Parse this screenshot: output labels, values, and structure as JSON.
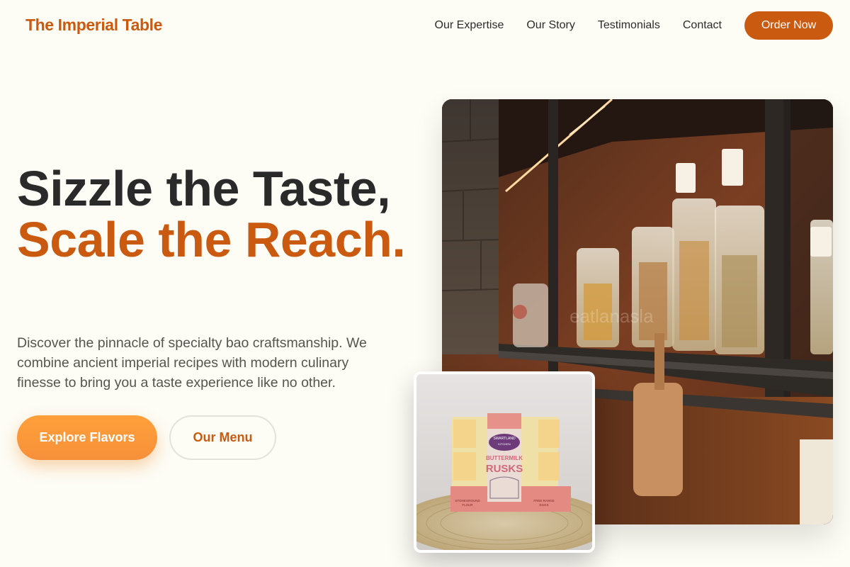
{
  "header": {
    "brand": "The Imperial Table",
    "nav": [
      {
        "label": "Our Expertise"
      },
      {
        "label": "Our Story"
      },
      {
        "label": "Testimonials"
      },
      {
        "label": "Contact"
      }
    ],
    "cta": "Order Now"
  },
  "hero": {
    "title_line1": "Sizzle the Taste,",
    "title_accent": "Scale the Reach.",
    "description": "Discover the pinnacle of specialty bao craftsmanship. We combine ancient imperial recipes with modern culinary finesse to bring you a taste experience like no other.",
    "primary_button": "Explore Flavors",
    "secondary_button": "Our Menu"
  },
  "images": {
    "main": {
      "icon": "pantry-shelves-photo",
      "watermark": "eatlanasla"
    },
    "thumb": {
      "icon": "rusks-package-photo",
      "brand_text": "SWARTLAND KITCHEN",
      "product_text": "BUTTERMILK RUSKS",
      "left_tag": "STONEGROUND FLOUR",
      "right_tag": "FREE RANGE EGGS"
    }
  },
  "colors": {
    "accent": "#c95a10",
    "button_primary": "#f7903a",
    "background": "#fdfcf5",
    "text": "#2a2a2a"
  }
}
